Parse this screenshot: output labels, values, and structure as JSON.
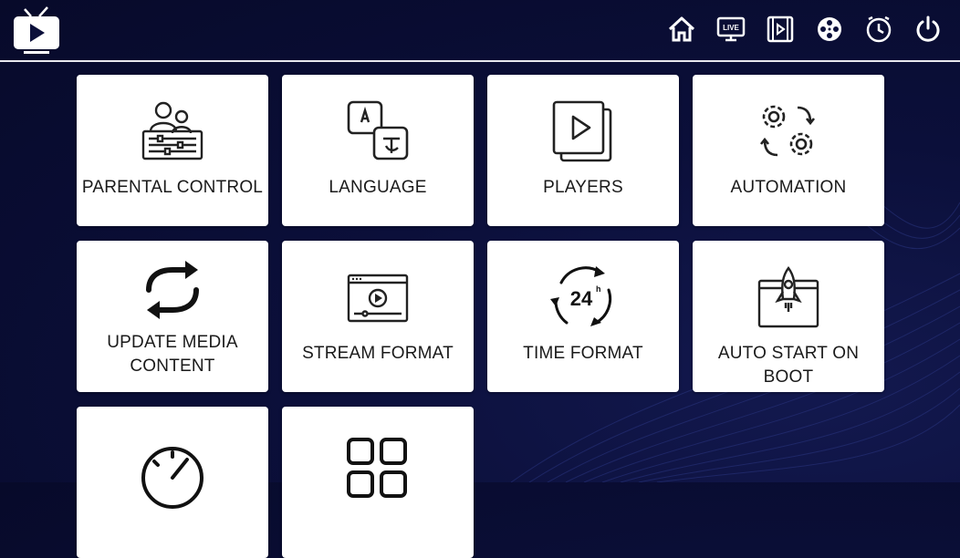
{
  "header": {
    "logo_icon": "tv-play-logo-icon",
    "nav_icons": [
      "home-icon",
      "live-tv-icon",
      "movies-icon",
      "film-reel-icon",
      "clock-icon",
      "power-icon"
    ],
    "live_badge": "LIVE"
  },
  "tiles": [
    {
      "label": "PARENTAL CONTROL",
      "icon": "parental-control-icon"
    },
    {
      "label": "LANGUAGE",
      "icon": "language-icon"
    },
    {
      "label": "PLAYERS",
      "icon": "players-icon"
    },
    {
      "label": "AUTOMATION",
      "icon": "automation-gears-icon"
    },
    {
      "label": "UPDATE MEDIA CONTENT",
      "icon": "refresh-icon"
    },
    {
      "label": "STREAM FORMAT",
      "icon": "stream-format-icon"
    },
    {
      "label": "TIME FORMAT",
      "icon": "time-format-24h-icon"
    },
    {
      "label": "AUTO START ON BOOT",
      "icon": "rocket-launch-icon"
    },
    {
      "label": "",
      "icon": "speedometer-icon"
    },
    {
      "label": "",
      "icon": "grid-layout-icon"
    }
  ],
  "time_badge": "24",
  "time_badge_h": "h",
  "colors": {
    "background": "#0b0f3a",
    "tile": "#ffffff",
    "text": "#1a1a1a"
  }
}
